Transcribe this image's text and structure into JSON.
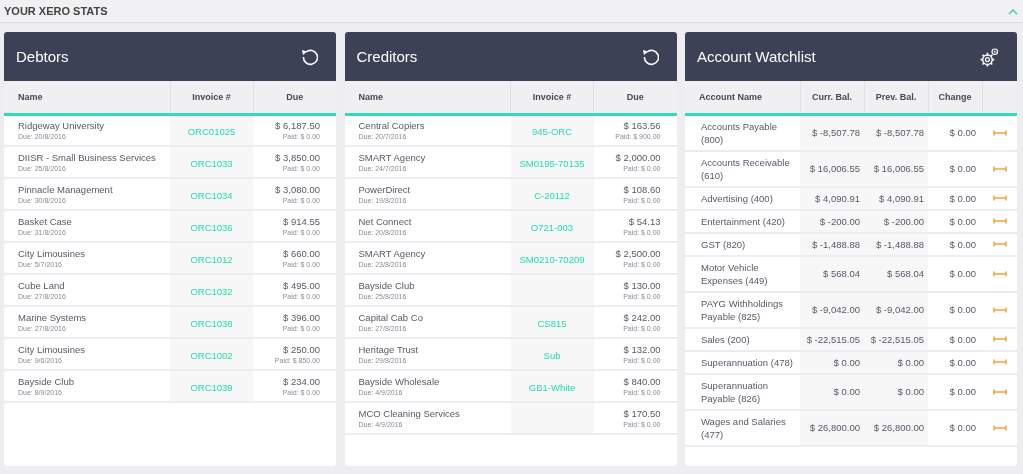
{
  "header": {
    "title": "YOUR XERO STATS",
    "expanded": true
  },
  "panels": [
    {
      "kind": "invoices",
      "title": "Debtors",
      "columns": [
        "Name",
        "Invoice #",
        "Due"
      ],
      "rows": [
        {
          "name": "Ridgeway University",
          "due": "Due: 20/8/2016",
          "invoice": "ORC01025",
          "amount": "$ 6,187.50",
          "paid": "Paid: $ 0.00"
        },
        {
          "name": "DIISR - Small Business Services",
          "due": "Due: 25/8/2016",
          "invoice": "ORC1033",
          "amount": "$ 3,850.00",
          "paid": "Paid: $ 0.00"
        },
        {
          "name": "Pinnacle Management",
          "due": "Due: 30/8/2016",
          "invoice": "ORC1034",
          "amount": "$ 3,080.00",
          "paid": "Paid: $ 0.00"
        },
        {
          "name": "Basket Case",
          "due": "Due: 31/8/2016",
          "invoice": "ORC1036",
          "amount": "$ 914.55",
          "paid": "Paid: $ 0.00"
        },
        {
          "name": "City Limousines",
          "due": "Due: 5/7/2016",
          "invoice": "ORC1012",
          "amount": "$ 660.00",
          "paid": "Paid: $ 0.00"
        },
        {
          "name": "Cube Land",
          "due": "Due: 27/8/2016",
          "invoice": "ORC1032",
          "amount": "$ 495.00",
          "paid": "Paid: $ 0.00"
        },
        {
          "name": "Marine Systems",
          "due": "Due: 27/8/2016",
          "invoice": "ORC1038",
          "amount": "$ 396.00",
          "paid": "Paid: $ 0.00"
        },
        {
          "name": "City Limousines",
          "due": "Due: 9/6/2016",
          "invoice": "ORC1002",
          "amount": "$ 250.00",
          "paid": "Paid: $ 850.00"
        },
        {
          "name": "Bayside Club",
          "due": "Due: 8/9/2016",
          "invoice": "ORC1039",
          "amount": "$ 234.00",
          "paid": "Paid: $ 0.00"
        }
      ]
    },
    {
      "kind": "invoices",
      "title": "Creditors",
      "columns": [
        "Name",
        "Invoice #",
        "Due"
      ],
      "rows": [
        {
          "name": "Central Copiers",
          "due": "Due: 20/7/2016",
          "invoice": "945-ORC",
          "amount": "$ 163.56",
          "paid": "Paid: $ 900.00"
        },
        {
          "name": "SMART Agency",
          "due": "Due: 24/7/2016",
          "invoice": "SM0195-70135",
          "amount": "$ 2,000.00",
          "paid": "Paid: $ 0.00"
        },
        {
          "name": "PowerDirect",
          "due": "Due: 19/8/2016",
          "invoice": "C-20112",
          "amount": "$ 108.60",
          "paid": "Paid: $ 0.00"
        },
        {
          "name": "Net Connect",
          "due": "Due: 20/8/2016",
          "invoice": "O721-003",
          "amount": "$ 54.13",
          "paid": "Paid: $ 0.00"
        },
        {
          "name": "SMART Agency",
          "due": "Due: 23/8/2016",
          "invoice": "SM0210-70209",
          "amount": "$ 2,500.00",
          "paid": "Paid: $ 0.00"
        },
        {
          "name": "Bayside Club",
          "due": "Due: 25/8/2016",
          "amount": "$ 130.00",
          "paid": "Paid: $ 0.00"
        },
        {
          "name": "Capital Cab Co",
          "due": "Due: 27/8/2016",
          "invoice": "CS815",
          "amount": "$ 242.00",
          "paid": "Paid: $ 0.00"
        },
        {
          "name": "Heritage Trust",
          "due": "Due: 29/8/2016",
          "invoice": "Sub",
          "amount": "$ 132.00",
          "paid": "Paid: $ 0.00"
        },
        {
          "name": "Bayside Wholesale",
          "due": "Due: 4/9/2016",
          "invoice": "GB1-White",
          "amount": "$ 840.00",
          "paid": "Paid: $ 0.00"
        },
        {
          "name": "MCO Cleaning Services",
          "due": "Due: 4/9/2016",
          "amount": "$ 170.50",
          "paid": "Paid: $ 0.00"
        }
      ]
    },
    {
      "kind": "watchlist",
      "title": "Account Watchlist",
      "columns": [
        "Account Name",
        "Curr. Bal.",
        "Prev. Bal.",
        "Change"
      ],
      "rows": [
        {
          "name": "Accounts Payable (800)",
          "current": "$ -8,507.78",
          "previous": "$ -8,507.78",
          "change": "$ 0.00"
        },
        {
          "name": "Accounts Receivable (610)",
          "current": "$ 16,006.55",
          "previous": "$ 16,006.55",
          "change": "$ 0.00"
        },
        {
          "name": "Advertising (400)",
          "current": "$ 4,090.91",
          "previous": "$ 4,090.91",
          "change": "$ 0.00"
        },
        {
          "name": "Entertainment (420)",
          "current": "$ -200.00",
          "previous": "$ -200.00",
          "change": "$ 0.00"
        },
        {
          "name": "GST (820)",
          "current": "$ -1,488.88",
          "previous": "$ -1,488.88",
          "change": "$ 0.00"
        },
        {
          "name": "Motor Vehicle Expenses (449)",
          "current": "$ 568.04",
          "previous": "$ 568.04",
          "change": "$ 0.00"
        },
        {
          "name": "PAYG Withholdings Payable (825)",
          "current": "$ -9,042.00",
          "previous": "$ -9,042.00",
          "change": "$ 0.00"
        },
        {
          "name": "Sales (200)",
          "current": "$ -22,515.05",
          "previous": "$ -22,515.05",
          "change": "$ 0.00"
        },
        {
          "name": "Superannuation (478)",
          "current": "$ 0.00",
          "previous": "$ 0.00",
          "change": "$ 0.00"
        },
        {
          "name": "Superannuation Payable (826)",
          "current": "$ 0.00",
          "previous": "$ 0.00",
          "change": "$ 0.00"
        },
        {
          "name": "Wages and Salaries (477)",
          "current": "$ 26,800.00",
          "previous": "$ 26,800.00",
          "change": "$ 0.00"
        }
      ]
    }
  ]
}
